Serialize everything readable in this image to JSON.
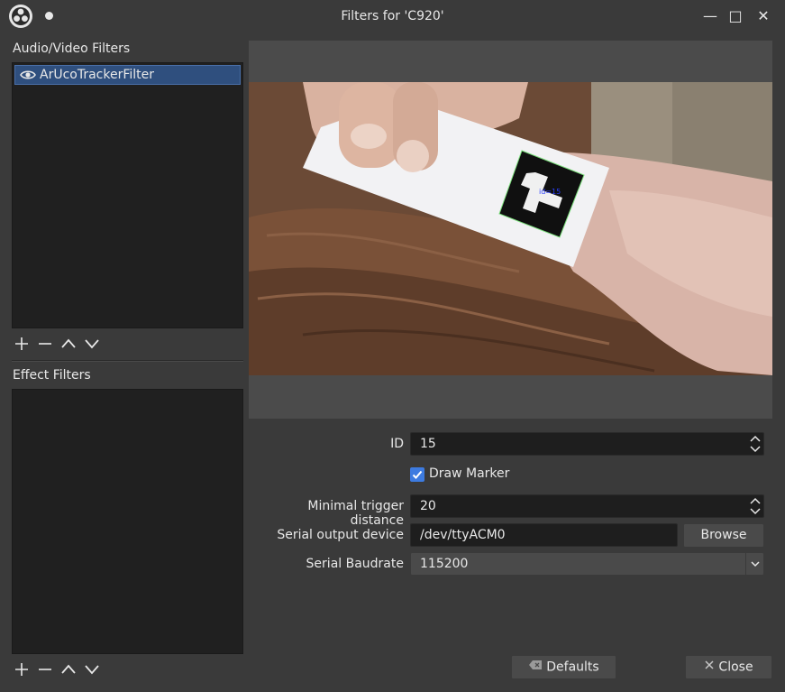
{
  "window": {
    "title": "Filters for 'C920'",
    "minimize_glyph": "—",
    "maximize_glyph": "□",
    "close_glyph": "✕"
  },
  "left_panel": {
    "av_filters_label": "Audio/Video Filters",
    "av_filters": [
      {
        "label": "ArUcoTrackerFilter",
        "visible": true,
        "selected": true
      }
    ],
    "effect_filters_label": "Effect Filters",
    "effect_filters": []
  },
  "preview": {
    "marker_overlay_text": "id=15"
  },
  "properties": {
    "id": {
      "label": "ID",
      "value": "15"
    },
    "draw_marker": {
      "label": "Draw Marker",
      "checked": true
    },
    "min_trigger_distance": {
      "label": "Minimal trigger distance",
      "value": "20"
    },
    "serial_output_device": {
      "label": "Serial output device",
      "value": "/dev/ttyACM0",
      "browse_label": "Browse"
    },
    "serial_baudrate": {
      "label": "Serial Baudrate",
      "value": "115200"
    }
  },
  "footer": {
    "defaults_label": "Defaults",
    "close_label": "Close"
  },
  "colors": {
    "window_bg": "#3a3a3a",
    "list_bg": "#202020",
    "selection_bg": "#2f4f7e",
    "accent": "#3d7be0"
  }
}
